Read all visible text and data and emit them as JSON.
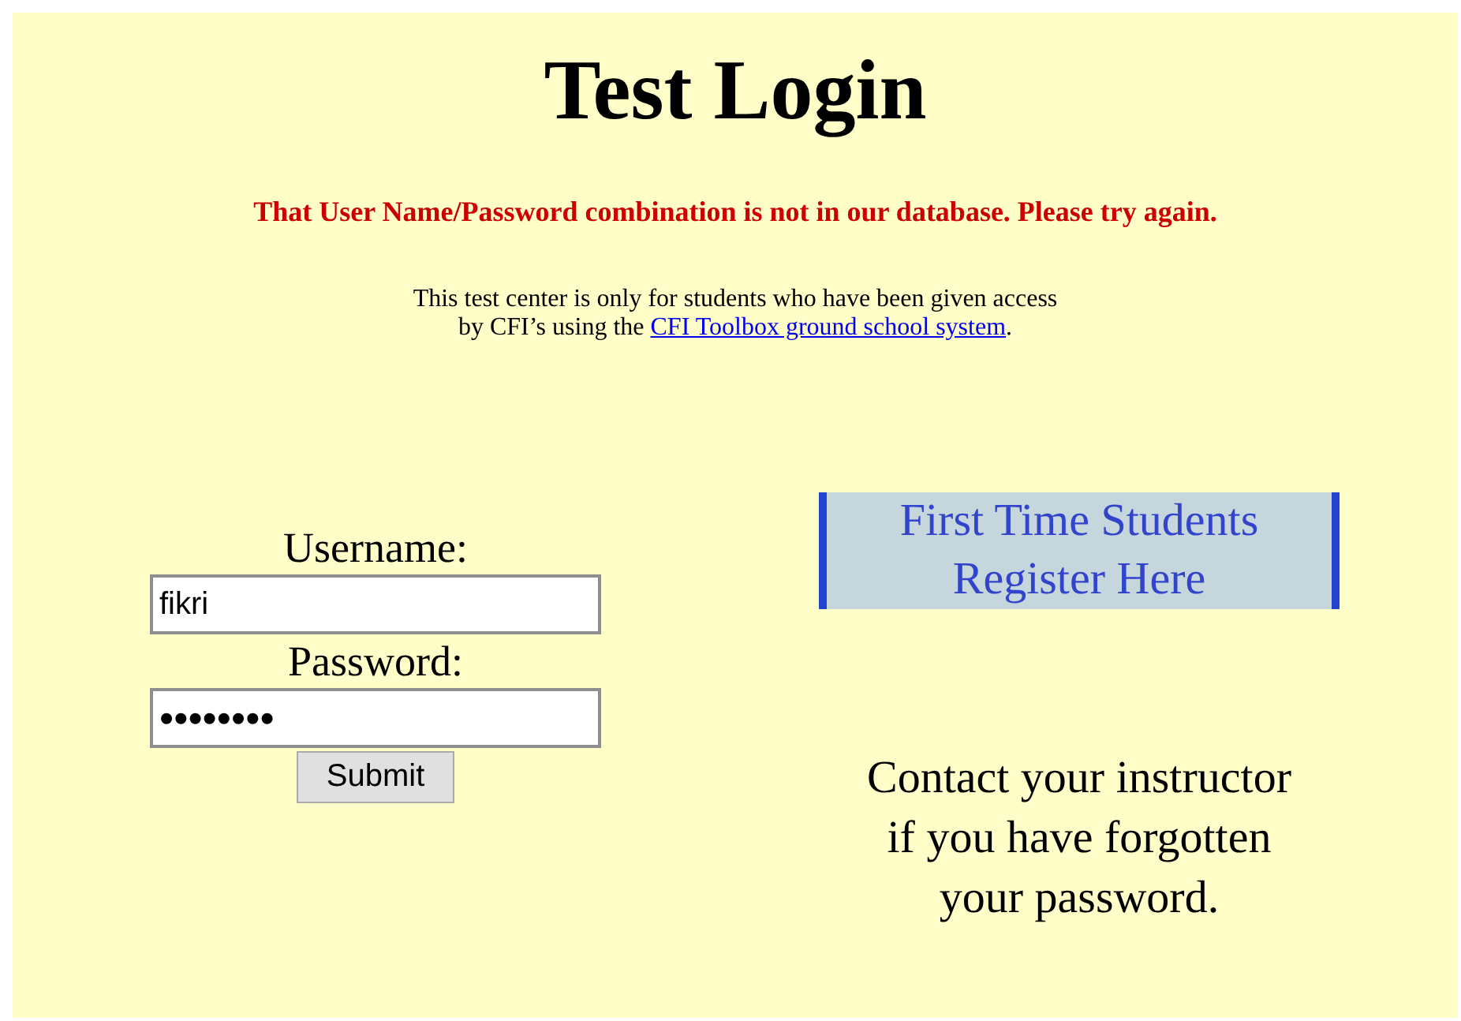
{
  "title": "Test Login",
  "error": "That User Name/Password combination is not in our database. Please try again.",
  "info": {
    "line1": "This test center is only for students who have been given access",
    "line2_before": "by CFI’s using the",
    "link": "CFI Toolbox ground school system",
    "line2_after": "."
  },
  "login": {
    "username_label": "Username:",
    "username_value": "fikri",
    "password_label": "Password:",
    "password_value": "••••••••",
    "submit": "Submit"
  },
  "register": {
    "line1": "First Time Students",
    "line2": "Register Here"
  },
  "forgot": {
    "lines": [
      "Contact your instructor",
      "if you have forgotten",
      "your password."
    ]
  }
}
